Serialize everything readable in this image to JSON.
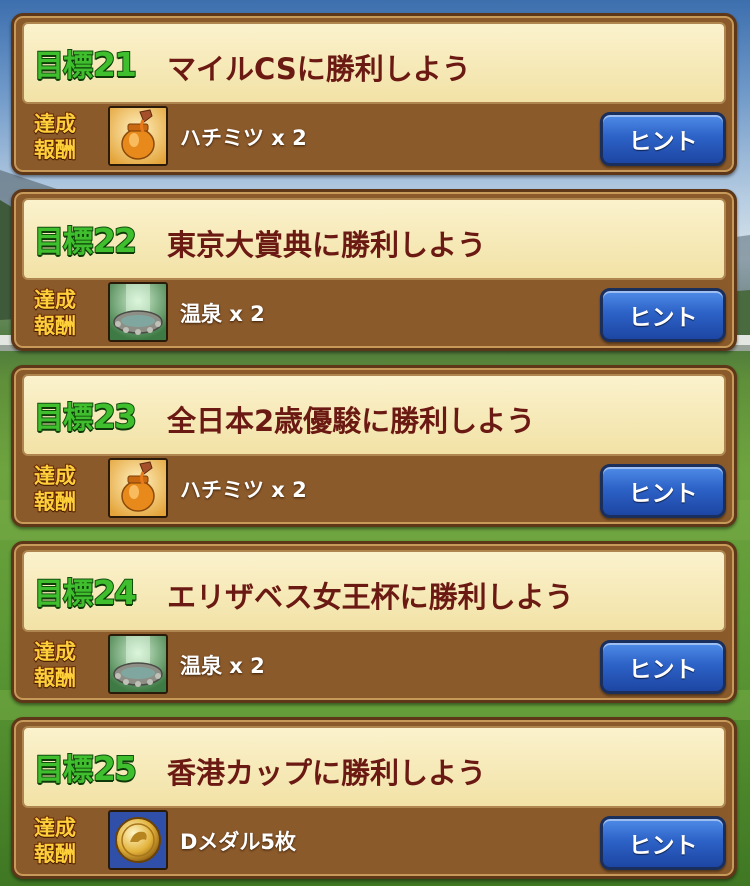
{
  "badge": {
    "line1": "達成",
    "line2": "報酬"
  },
  "hint_label": "ヒント",
  "goals": [
    {
      "tag": "目標",
      "number": "21",
      "title": "マイルCSに勝利しよう",
      "reward": "ハチミツ x 2",
      "reward_icon": "honey-pot-icon"
    },
    {
      "tag": "目標",
      "number": "22",
      "title": "東京大賞典に勝利しよう",
      "reward": "温泉 x 2",
      "reward_icon": "hot-spring-icon"
    },
    {
      "tag": "目標",
      "number": "23",
      "title": "全日本2歳優駿に勝利しよう",
      "reward": "ハチミツ x 2",
      "reward_icon": "honey-pot-icon"
    },
    {
      "tag": "目標",
      "number": "24",
      "title": "エリザベス女王杯に勝利しよう",
      "reward": "温泉 x 2",
      "reward_icon": "hot-spring-icon"
    },
    {
      "tag": "目標",
      "number": "25",
      "title": "香港カップに勝利しよう",
      "reward": "Dメダル5枚",
      "reward_icon": "gold-medal-icon"
    }
  ]
}
